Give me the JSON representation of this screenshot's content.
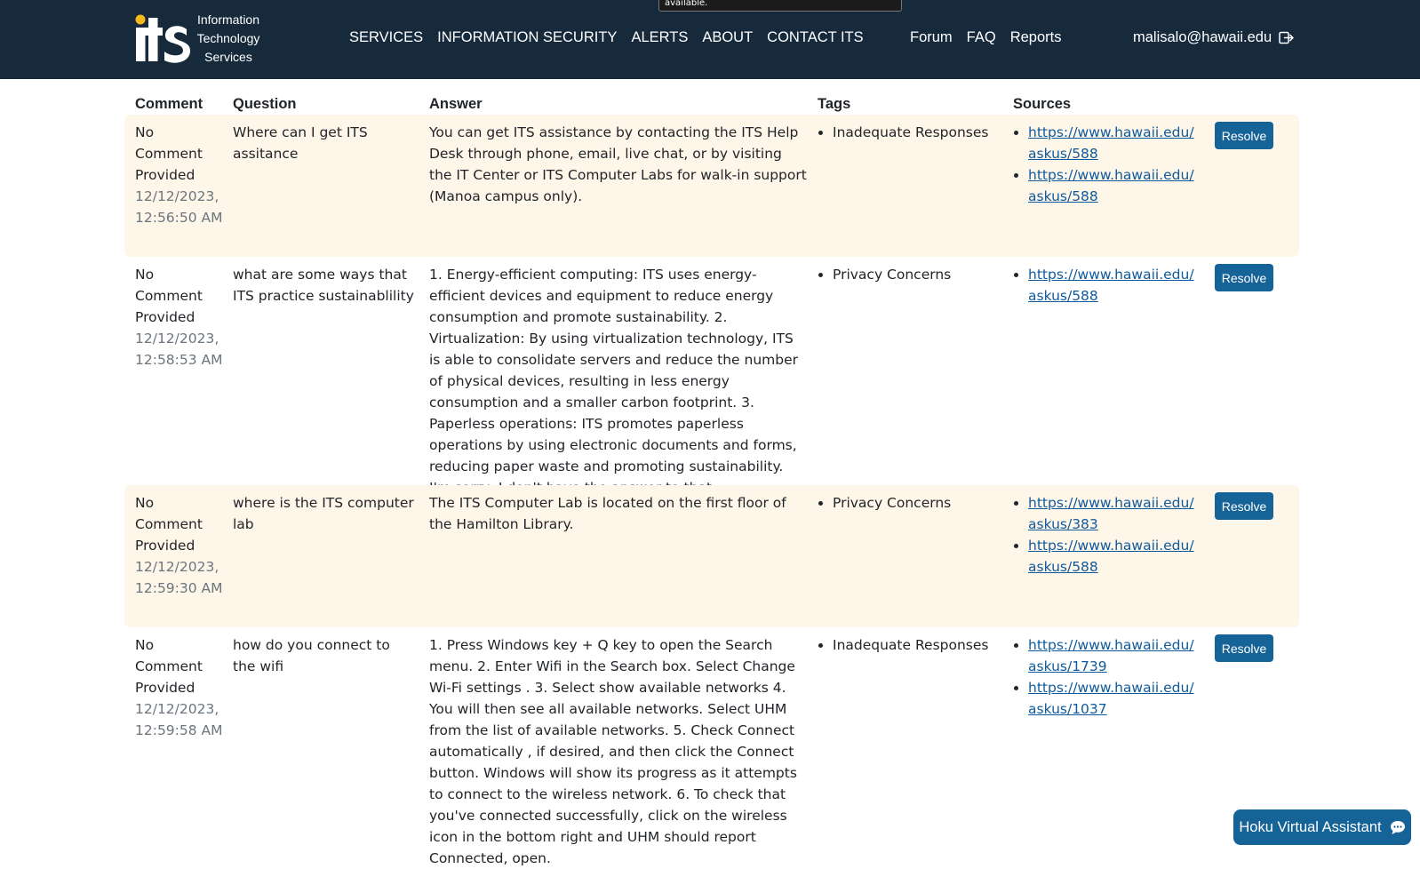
{
  "tooltip_fragment": "available.",
  "header": {
    "logo_text": "its",
    "logo_lines": [
      "Information",
      "Technology",
      "Services"
    ],
    "main_nav": [
      "SERVICES",
      "INFORMATION SECURITY",
      "ALERTS",
      "ABOUT",
      "CONTACT ITS"
    ],
    "secondary_nav": [
      "Forum",
      "FAQ",
      "Reports"
    ],
    "user_email": "malisalo@hawaii.edu"
  },
  "table": {
    "columns": [
      "Comment",
      "Question",
      "Answer",
      "Tags",
      "Sources"
    ],
    "resolve_label": "Resolve",
    "rows": [
      {
        "comment": "No Comment Provided",
        "timestamp": "12/12/2023, 12:56:50 AM",
        "question": "Where can I get ITS assitance",
        "answer": "You can get ITS assistance by contacting the ITS Help Desk through phone, email, live chat, or by visiting the IT Center or ITS Computer Labs for walk-in support (Manoa campus only).",
        "tags": [
          "Inadequate Responses"
        ],
        "sources": [
          "https://www.hawaii.edu/askus/588",
          "https://www.hawaii.edu/askus/588"
        ]
      },
      {
        "comment": "No Comment Provided",
        "timestamp": "12/12/2023, 12:58:53 AM",
        "question": "what are some ways that ITS practice sustainablility",
        "answer": "1. Energy-efficient computing: ITS uses energy-efficient devices and equipment to reduce energy consumption and promote sustainability. 2. Virtualization: By using virtualization technology, ITS is able to consolidate servers and reduce the number of physical devices, resulting in less energy consumption and a smaller carbon footprint. 3. Paperless operations: ITS promotes paperless operations by using electronic documents and forms, reducing paper waste and promoting sustainability. I'm sorry, I don't have the answer to that.",
        "tags": [
          "Privacy Concerns"
        ],
        "sources": [
          "https://www.hawaii.edu/askus/588"
        ]
      },
      {
        "comment": "No Comment Provided",
        "timestamp": "12/12/2023, 12:59:30 AM",
        "question": "where is the ITS computer lab",
        "answer": "The ITS Computer Lab is located on the first floor of the Hamilton Library.",
        "tags": [
          "Privacy Concerns"
        ],
        "sources": [
          "https://www.hawaii.edu/askus/383",
          "https://www.hawaii.edu/askus/588"
        ]
      },
      {
        "comment": "No Comment Provided",
        "timestamp": "12/12/2023, 12:59:58 AM",
        "question": "how do you connect to the wifi",
        "answer": "1. Press Windows key + Q key to open the Search menu. 2. Enter Wifi in the Search box. Select Change Wi-Fi settings . 3. Select show available networks 4. You will then see all available networks. Select UHM from the list of available networks. 5. Check Connect automatically , if desired, and then click the Connect button. Windows will show its progress as it attempts to connect to the wireless network. 6. To check that you've connected successfully, click on the wireless icon in the bottom right and UHM should report Connected, open.",
        "tags": [
          "Inadequate Responses"
        ],
        "sources": [
          "https://www.hawaii.edu/askus/1739",
          "https://www.hawaii.edu/askus/1037"
        ]
      }
    ]
  },
  "assistant": {
    "label": "Hoku Virtual Assistant",
    "icon": "chat-bubble-icon"
  },
  "colors": {
    "header_bg": "#162a3c",
    "row_highlight": "#fff6ea",
    "button_bg": "#156397",
    "link": "#0f5a9c",
    "logo_dot": "#f5b819"
  }
}
